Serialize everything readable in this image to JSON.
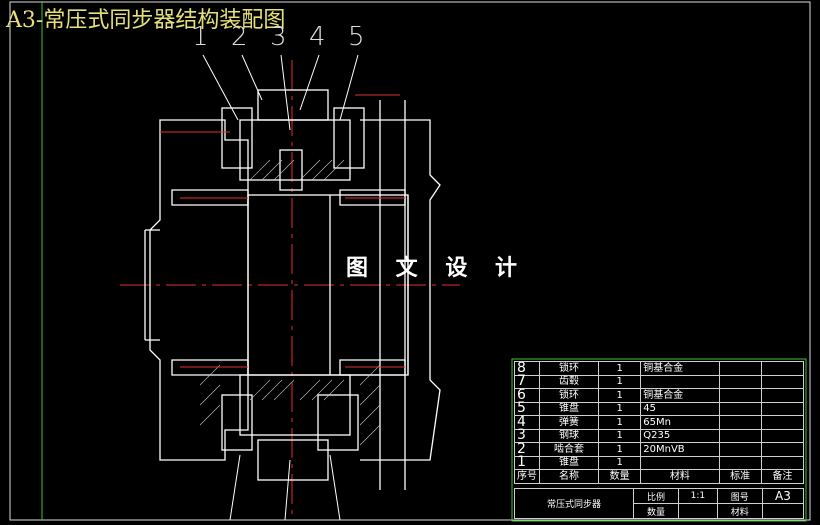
{
  "title": "A3-常压式同步器结构装配图",
  "callouts": [
    "1",
    "2",
    "3",
    "4",
    "5"
  ],
  "watermark": "图 文 设 计",
  "bom": {
    "rows": [
      {
        "no": "8",
        "name": "锁环",
        "qty": "1",
        "material": "铜基合金"
      },
      {
        "no": "7",
        "name": "齿毂",
        "qty": "1",
        "material": ""
      },
      {
        "no": "6",
        "name": "锁环",
        "qty": "1",
        "material": "铜基合金"
      },
      {
        "no": "5",
        "name": "锥盘",
        "qty": "1",
        "material": "45"
      },
      {
        "no": "4",
        "name": "弹簧",
        "qty": "1",
        "material": "65Mn"
      },
      {
        "no": "3",
        "name": "钢球",
        "qty": "1",
        "material": "Q235"
      },
      {
        "no": "2",
        "name": "啮合套",
        "qty": "1",
        "material": "20MnVB"
      },
      {
        "no": "1",
        "name": "锥盘",
        "qty": "1",
        "material": ""
      }
    ],
    "header": {
      "no": "序号",
      "name": "名称",
      "qty": "数量",
      "material": "材料",
      "standard": "标准",
      "remark": "备注"
    }
  },
  "title_block": {
    "name": "常压式同步器",
    "scale_label": "比例",
    "scale": "1:1",
    "drawing_no_label": "图号",
    "drawing_no": "A3",
    "qty_label": "数量",
    "material_label": "材料"
  },
  "colors": {
    "frame": "#ffffff",
    "border_green": "#3cc43c",
    "center_line": "#e03030",
    "title": "#e6e07a"
  }
}
